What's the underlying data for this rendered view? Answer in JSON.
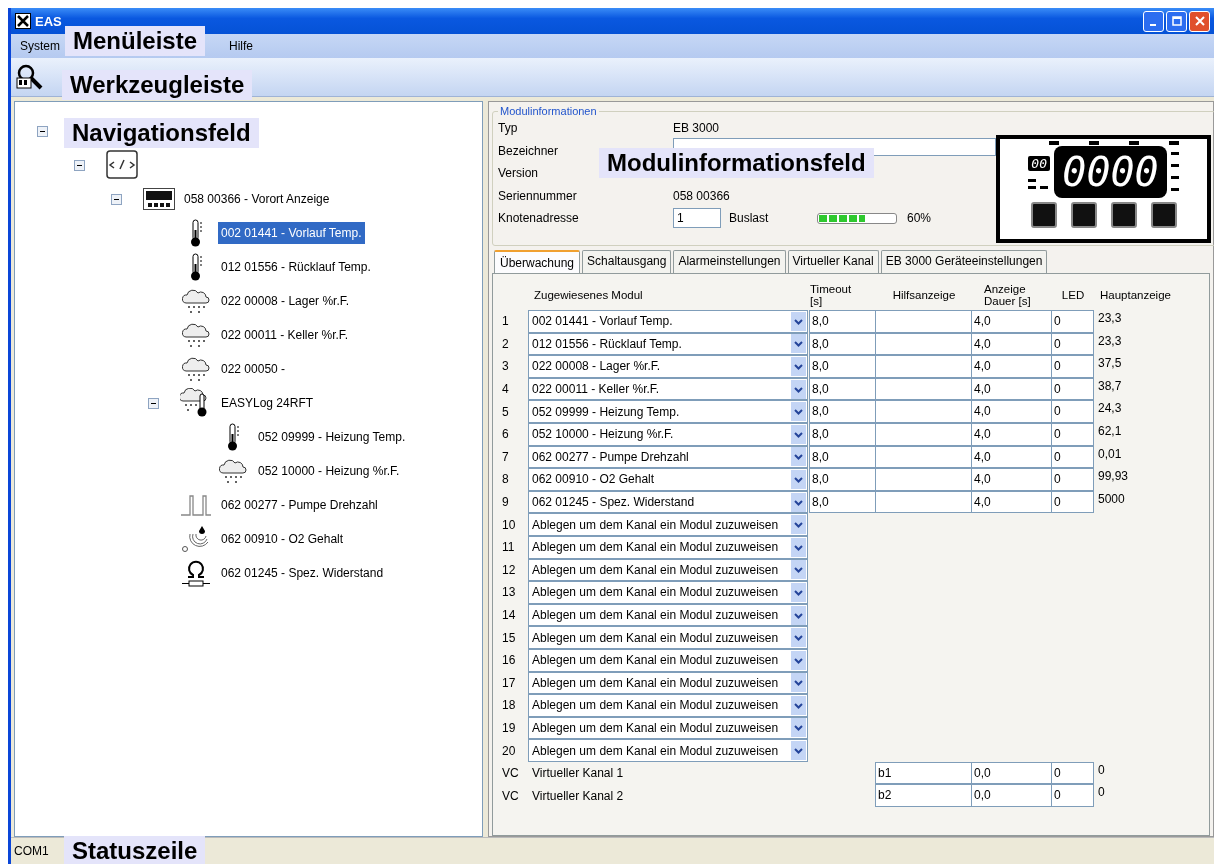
{
  "window": {
    "title": "EAS"
  },
  "menu": [
    "System",
    "Hilfe"
  ],
  "tree": [
    {
      "expanded": true,
      "children": [
        {
          "kind": "bus",
          "expanded": true,
          "children": [
            {
              "kind": "display",
              "label": "058 00366 - Vorort Anzeige",
              "expanded": true,
              "selected": false,
              "children": [
                {
                  "kind": "thermometer",
                  "label": "002 01441 - Vorlauf Temp.",
                  "selected": true
                },
                {
                  "kind": "thermometer",
                  "label": "012 01556 - Rücklauf Temp.",
                  "selected": false
                },
                {
                  "kind": "humidity",
                  "label": "022 00008 - Lager %r.F.",
                  "selected": false
                },
                {
                  "kind": "humidity",
                  "label": "022 00011 - Keller %r.F.",
                  "selected": false
                },
                {
                  "kind": "humidity",
                  "label": "022 00050 -",
                  "selected": false
                },
                {
                  "kind": "combo",
                  "label": "EASYLog 24RFT",
                  "expanded": true,
                  "selected": false,
                  "children": [
                    {
                      "kind": "thermometer",
                      "label": "052 09999 - Heizung Temp.",
                      "selected": false
                    },
                    {
                      "kind": "humidity",
                      "label": "052 10000 - Heizung %r.F.",
                      "selected": false
                    }
                  ]
                },
                {
                  "kind": "pulse",
                  "label": "062 00277 - Pumpe Drehzahl",
                  "selected": false
                },
                {
                  "kind": "oxygen",
                  "label": "062 00910 - O2 Gehalt",
                  "selected": false
                },
                {
                  "kind": "resistance",
                  "label": "062 01245 - Spez. Widerstand",
                  "selected": false
                }
              ]
            }
          ]
        }
      ]
    }
  ],
  "module_info": {
    "title": "Modulinformationen",
    "fields": [
      {
        "label": "Typ",
        "value": "EB 3000",
        "kind": "text"
      },
      {
        "label": "Bezeichner",
        "kind": "input"
      },
      {
        "label": "Version",
        "kind": "text"
      },
      {
        "label": "Seriennummer",
        "value": "058 00366",
        "kind": "text"
      }
    ],
    "node_address": {
      "label": "Knotenadresse",
      "value": "1"
    },
    "bus_load": {
      "label": "Buslast",
      "level": 0.6,
      "reading": "60%"
    },
    "display": {
      "small": "00",
      "main": "0000"
    }
  },
  "tabs": [
    {
      "label": "Überwachung",
      "selected": true
    },
    {
      "label": "Schaltausgang",
      "selected": false
    },
    {
      "label": "Alarmeinstellungen",
      "selected": false
    },
    {
      "label": "Virtueller Kanal",
      "selected": false
    },
    {
      "label": "EB 3000 Geräteeinstellungen",
      "selected": false
    }
  ],
  "table": {
    "columns": [
      "Zugewiesenes Modul",
      "Timeout\n[s]",
      "Hilfsanzeige",
      "Anzeige\nDauer [s]",
      "LED",
      "Hauptanzeige"
    ],
    "rows": [
      {
        "kind": "assigned",
        "number": "1",
        "module": "002 01441 - Vorlauf Temp.",
        "timeout": "8,0",
        "duration": "4,0",
        "led": "0",
        "main": "23,3"
      },
      {
        "kind": "assigned",
        "number": "2",
        "module": "012 01556 - Rücklauf Temp.",
        "timeout": "8,0",
        "duration": "4,0",
        "led": "0",
        "main": "23,3"
      },
      {
        "kind": "assigned",
        "number": "3",
        "module": "022 00008 - Lager %r.F.",
        "timeout": "8,0",
        "duration": "4,0",
        "led": "0",
        "main": "37,5"
      },
      {
        "kind": "assigned",
        "number": "4",
        "module": "022 00011 - Keller %r.F.",
        "timeout": "8,0",
        "duration": "4,0",
        "led": "0",
        "main": "38,7"
      },
      {
        "kind": "assigned",
        "number": "5",
        "module": "052 09999 - Heizung Temp.",
        "timeout": "8,0",
        "duration": "4,0",
        "led": "0",
        "main": "24,3"
      },
      {
        "kind": "assigned",
        "number": "6",
        "module": "052 10000 - Heizung %r.F.",
        "timeout": "8,0",
        "duration": "4,0",
        "led": "0",
        "main": "62,1"
      },
      {
        "kind": "assigned",
        "number": "7",
        "module": "062 00277 - Pumpe Drehzahl",
        "timeout": "8,0",
        "duration": "4,0",
        "led": "0",
        "main": "0,01"
      },
      {
        "kind": "assigned",
        "number": "8",
        "module": "062 00910 - O2 Gehalt",
        "timeout": "8,0",
        "duration": "4,0",
        "led": "0",
        "main": "99,93"
      },
      {
        "kind": "assigned",
        "number": "9",
        "module": "062 01245 - Spez. Widerstand",
        "timeout": "8,0",
        "duration": "4,0",
        "led": "0",
        "main": "5000"
      },
      {
        "kind": "empty",
        "number": "10",
        "module": "Ablegen um dem Kanal ein Modul zuzuweisen"
      },
      {
        "kind": "empty",
        "number": "11",
        "module": "Ablegen um dem Kanal ein Modul zuzuweisen"
      },
      {
        "kind": "empty",
        "number": "12",
        "module": "Ablegen um dem Kanal ein Modul zuzuweisen"
      },
      {
        "kind": "empty",
        "number": "13",
        "module": "Ablegen um dem Kanal ein Modul zuzuweisen"
      },
      {
        "kind": "empty",
        "number": "14",
        "module": "Ablegen um dem Kanal ein Modul zuzuweisen"
      },
      {
        "kind": "empty",
        "number": "15",
        "module": "Ablegen um dem Kanal ein Modul zuzuweisen"
      },
      {
        "kind": "empty",
        "number": "16",
        "module": "Ablegen um dem Kanal ein Modul zuzuweisen"
      },
      {
        "kind": "empty",
        "number": "17",
        "module": "Ablegen um dem Kanal ein Modul zuzuweisen"
      },
      {
        "kind": "empty",
        "number": "18",
        "module": "Ablegen um dem Kanal ein Modul zuzuweisen"
      },
      {
        "kind": "empty",
        "number": "19",
        "module": "Ablegen um dem Kanal ein Modul zuzuweisen"
      },
      {
        "kind": "empty",
        "number": "20",
        "module": "Ablegen um dem Kanal ein Modul zuzuweisen"
      },
      {
        "kind": "virtual",
        "number": "VC",
        "module": "Virtueller Kanal 1",
        "aux": "b1",
        "duration": "0,0",
        "led": "0",
        "main": "0"
      },
      {
        "kind": "virtual",
        "number": "VC",
        "module": "Virtueller Kanal 2",
        "aux": "b2",
        "duration": "0,0",
        "led": "0",
        "main": "0"
      }
    ]
  },
  "status_bar": {
    "port": "COM1"
  },
  "callouts": [
    "Menüleiste",
    "Werkzeugleiste",
    "Navigationsfeld",
    "Modulinformationsfeld",
    "Statuszeile"
  ]
}
